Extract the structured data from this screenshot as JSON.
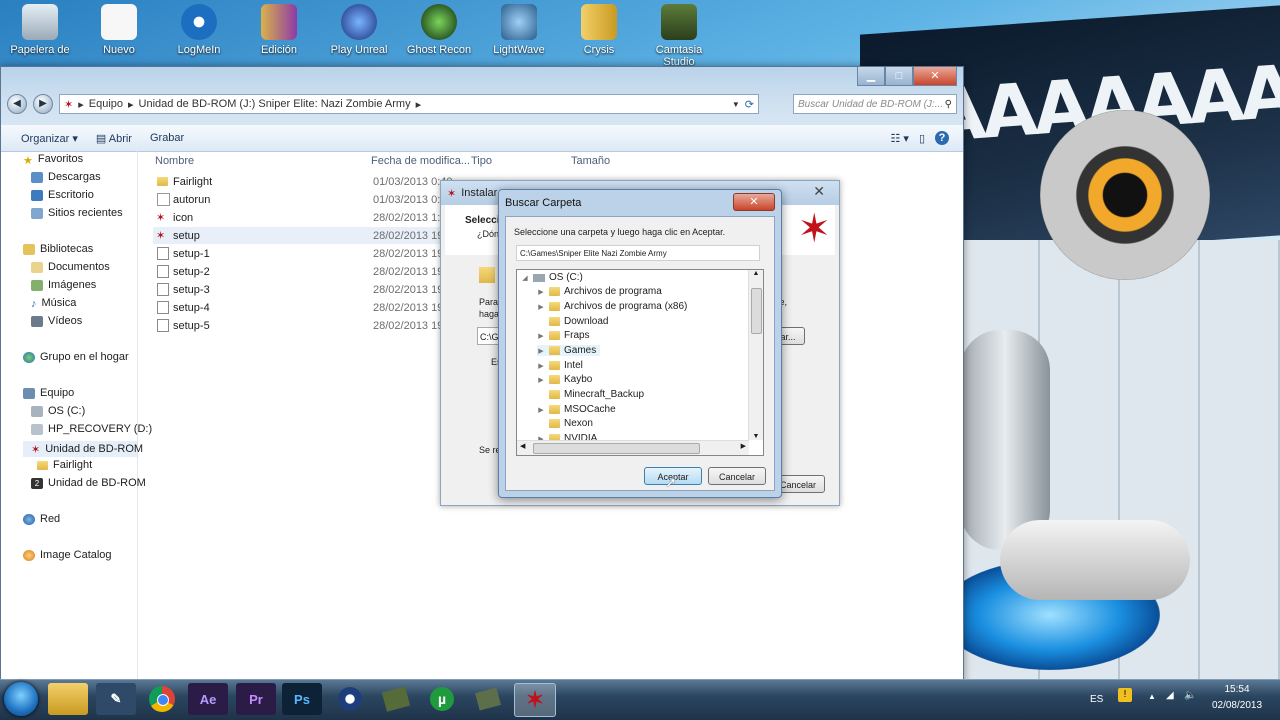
{
  "desktop": {
    "icons": [
      "Papelera de",
      "Nuevo",
      "LogMeIn",
      "Edición",
      "Play Unreal",
      "Ghost Recon",
      "LightWave",
      "Crysis",
      "Camtasia Studio"
    ]
  },
  "explorer": {
    "address": [
      "Equipo",
      "Unidad de BD-ROM (J:) Sniper Elite: Nazi Zombie Army"
    ],
    "search_placeholder": "Buscar Unidad de BD-ROM (J:...",
    "toolbar": {
      "organize": "Organizar",
      "open": "Abrir",
      "burn": "Grabar"
    },
    "nav": {
      "favorites": "Favoritos",
      "downloads": "Descargas",
      "desktop": "Escritorio",
      "recent": "Sitios recientes",
      "libraries": "Bibliotecas",
      "documents": "Documentos",
      "images": "Imágenes",
      "music": "Música",
      "videos": "Vídeos",
      "homegroup": "Grupo en el hogar",
      "computer": "Equipo",
      "os": "OS (C:)",
      "recovery": "HP_RECOVERY (D:)",
      "bdrom1": "Unidad de BD-ROM",
      "fairlight": "Fairlight",
      "bdrom2": "Unidad de BD-ROM",
      "network": "Red",
      "catalog": "Image Catalog"
    },
    "columns": {
      "name": "Nombre",
      "date": "Fecha de modifica...",
      "type": "Tipo",
      "size": "Tamaño"
    },
    "files": [
      {
        "name": "Fairlight",
        "date": "01/03/2013 0:40"
      },
      {
        "name": "autorun",
        "date": "01/03/2013 0:45"
      },
      {
        "name": "icon",
        "date": "28/02/2013 1:51"
      },
      {
        "name": "setup",
        "date": "28/02/2013 19:1"
      },
      {
        "name": "setup-1",
        "date": "28/02/2013 19:1"
      },
      {
        "name": "setup-2",
        "date": "28/02/2013 19:1"
      },
      {
        "name": "setup-3",
        "date": "28/02/2013 19:1"
      },
      {
        "name": "setup-4",
        "date": "28/02/2013 19:1"
      },
      {
        "name": "setup-5",
        "date": "28/02/2013 19:1"
      }
    ]
  },
  "installer": {
    "title": "Instalar",
    "heading": "Selecci",
    "subheading": "¿Dónd",
    "para": "Para",
    "haga": "haga",
    "path": "C:\\G",
    "es": "Es",
    "sere": "Se re",
    "te": "te,",
    "browse": "ar...",
    "cancel": "Cancelar"
  },
  "dialog": {
    "title": "Buscar Carpeta",
    "instruction": "Seleccione una carpeta y luego haga clic en Aceptar.",
    "path": "C:\\Games\\Sniper Elite Nazi Zombie Army",
    "root": "OS (C:)",
    "folders": [
      "Archivos de programa",
      "Archivos de programa (x86)",
      "Download",
      "Fraps",
      "Games",
      "Intel",
      "Kaybo",
      "Minecraft_Backup",
      "MSOCache",
      "Nexon",
      "NVIDIA"
    ],
    "ok": "Aceptar",
    "cancel": "Cancelar"
  },
  "taskbar": {
    "apps": [
      "Ae",
      "Pr",
      "Ps"
    ],
    "lang": "ES",
    "time": "15:54",
    "date": "02/08/2013"
  },
  "wallpaper_text": "AAAAAAAC"
}
